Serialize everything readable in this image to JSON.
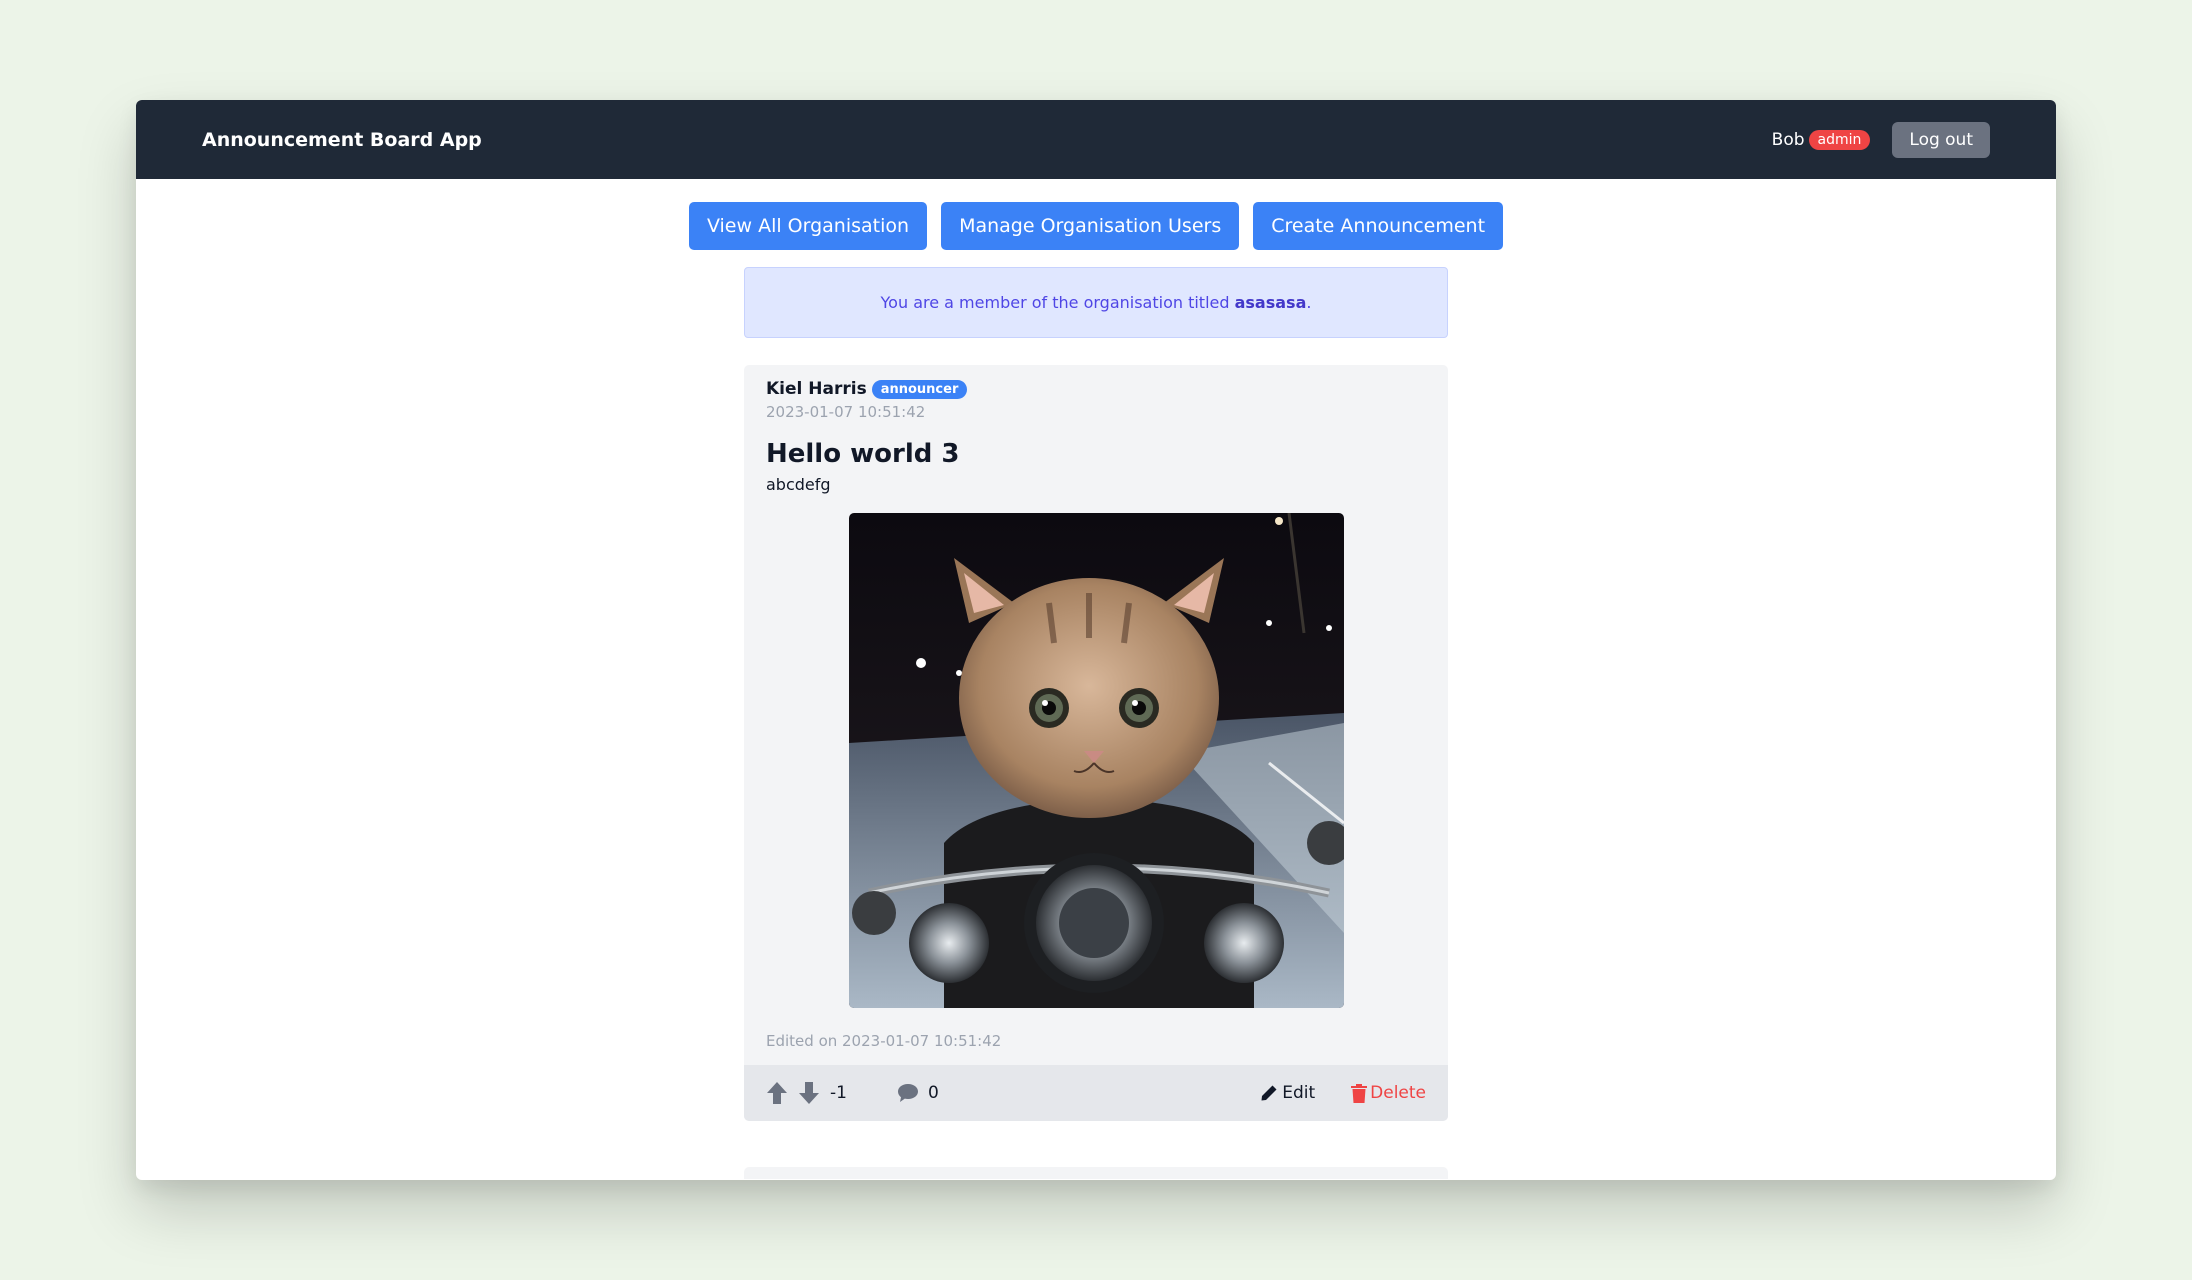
{
  "app": {
    "brand": "Announcement Board App",
    "user_name": "Bob",
    "user_role": "admin",
    "logout_label": "Log out"
  },
  "actions": {
    "view_orgs": "View All Organisation",
    "manage_users": "Manage Organisation Users",
    "create_announcement": "Create Announcement"
  },
  "notice": {
    "prefix": "You are a member of the organisation titled ",
    "org_name": "asasasa",
    "suffix": "."
  },
  "post": {
    "author": "Kiel Harris",
    "author_role": "announcer",
    "date": "2023-01-07 10:51:42",
    "title": "Hello world 3",
    "body": "abcdefg",
    "edited": "Edited on 2023-01-07 10:51:42",
    "votes": "-1",
    "comments": "0",
    "edit_label": "Edit",
    "delete_label": "Delete",
    "icons": {
      "upvote": "arrow-up-icon",
      "downvote": "arrow-down-icon",
      "comment": "comment-icon",
      "edit": "pencil-icon",
      "delete": "trash-icon"
    }
  },
  "colors": {
    "navbar": "#1f2937",
    "primary": "#3b82f6",
    "danger": "#ef4444",
    "notice_bg": "#e0e7ff",
    "notice_text": "#4f46e5"
  }
}
